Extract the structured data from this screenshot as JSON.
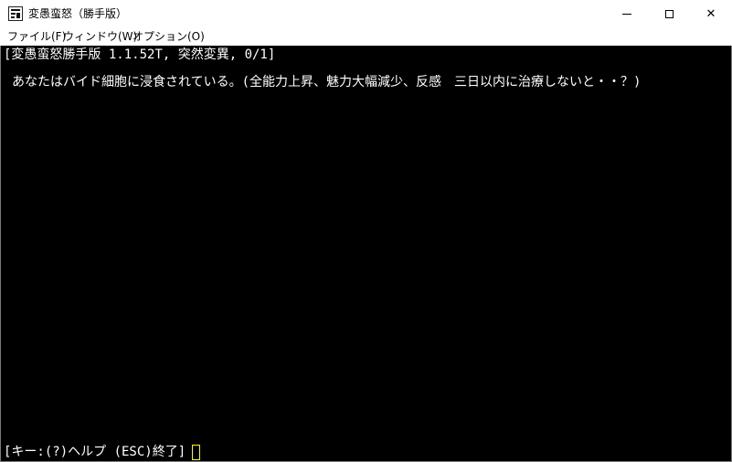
{
  "window": {
    "title": "変愚蛮怒（勝手版）",
    "icon": "app-icon",
    "controls": {
      "minimize_icon": "minimize-icon",
      "maximize_icon": "maximize-icon",
      "close_glyph": "✕"
    }
  },
  "menubar": {
    "items": [
      {
        "label": "ファイル(F)"
      },
      {
        "label": "ウィンドウ(W)"
      },
      {
        "label": "オプション(O)"
      }
    ]
  },
  "console": {
    "header": "[変愚蛮怒勝手版 1.1.52T, 突然変異, 0/1]",
    "message": "あなたはバイド細胞に浸食されている。(全能力上昇、魅力大幅減少、反感　三日以内に治療しないと・・？)",
    "prompt": "[キー:(?)ヘルプ (ESC)終了]"
  },
  "colors": {
    "console_bg": "#000000",
    "console_text": "#ffffff",
    "cursor": "#ffff00",
    "chrome_bg": "#ffffff"
  }
}
